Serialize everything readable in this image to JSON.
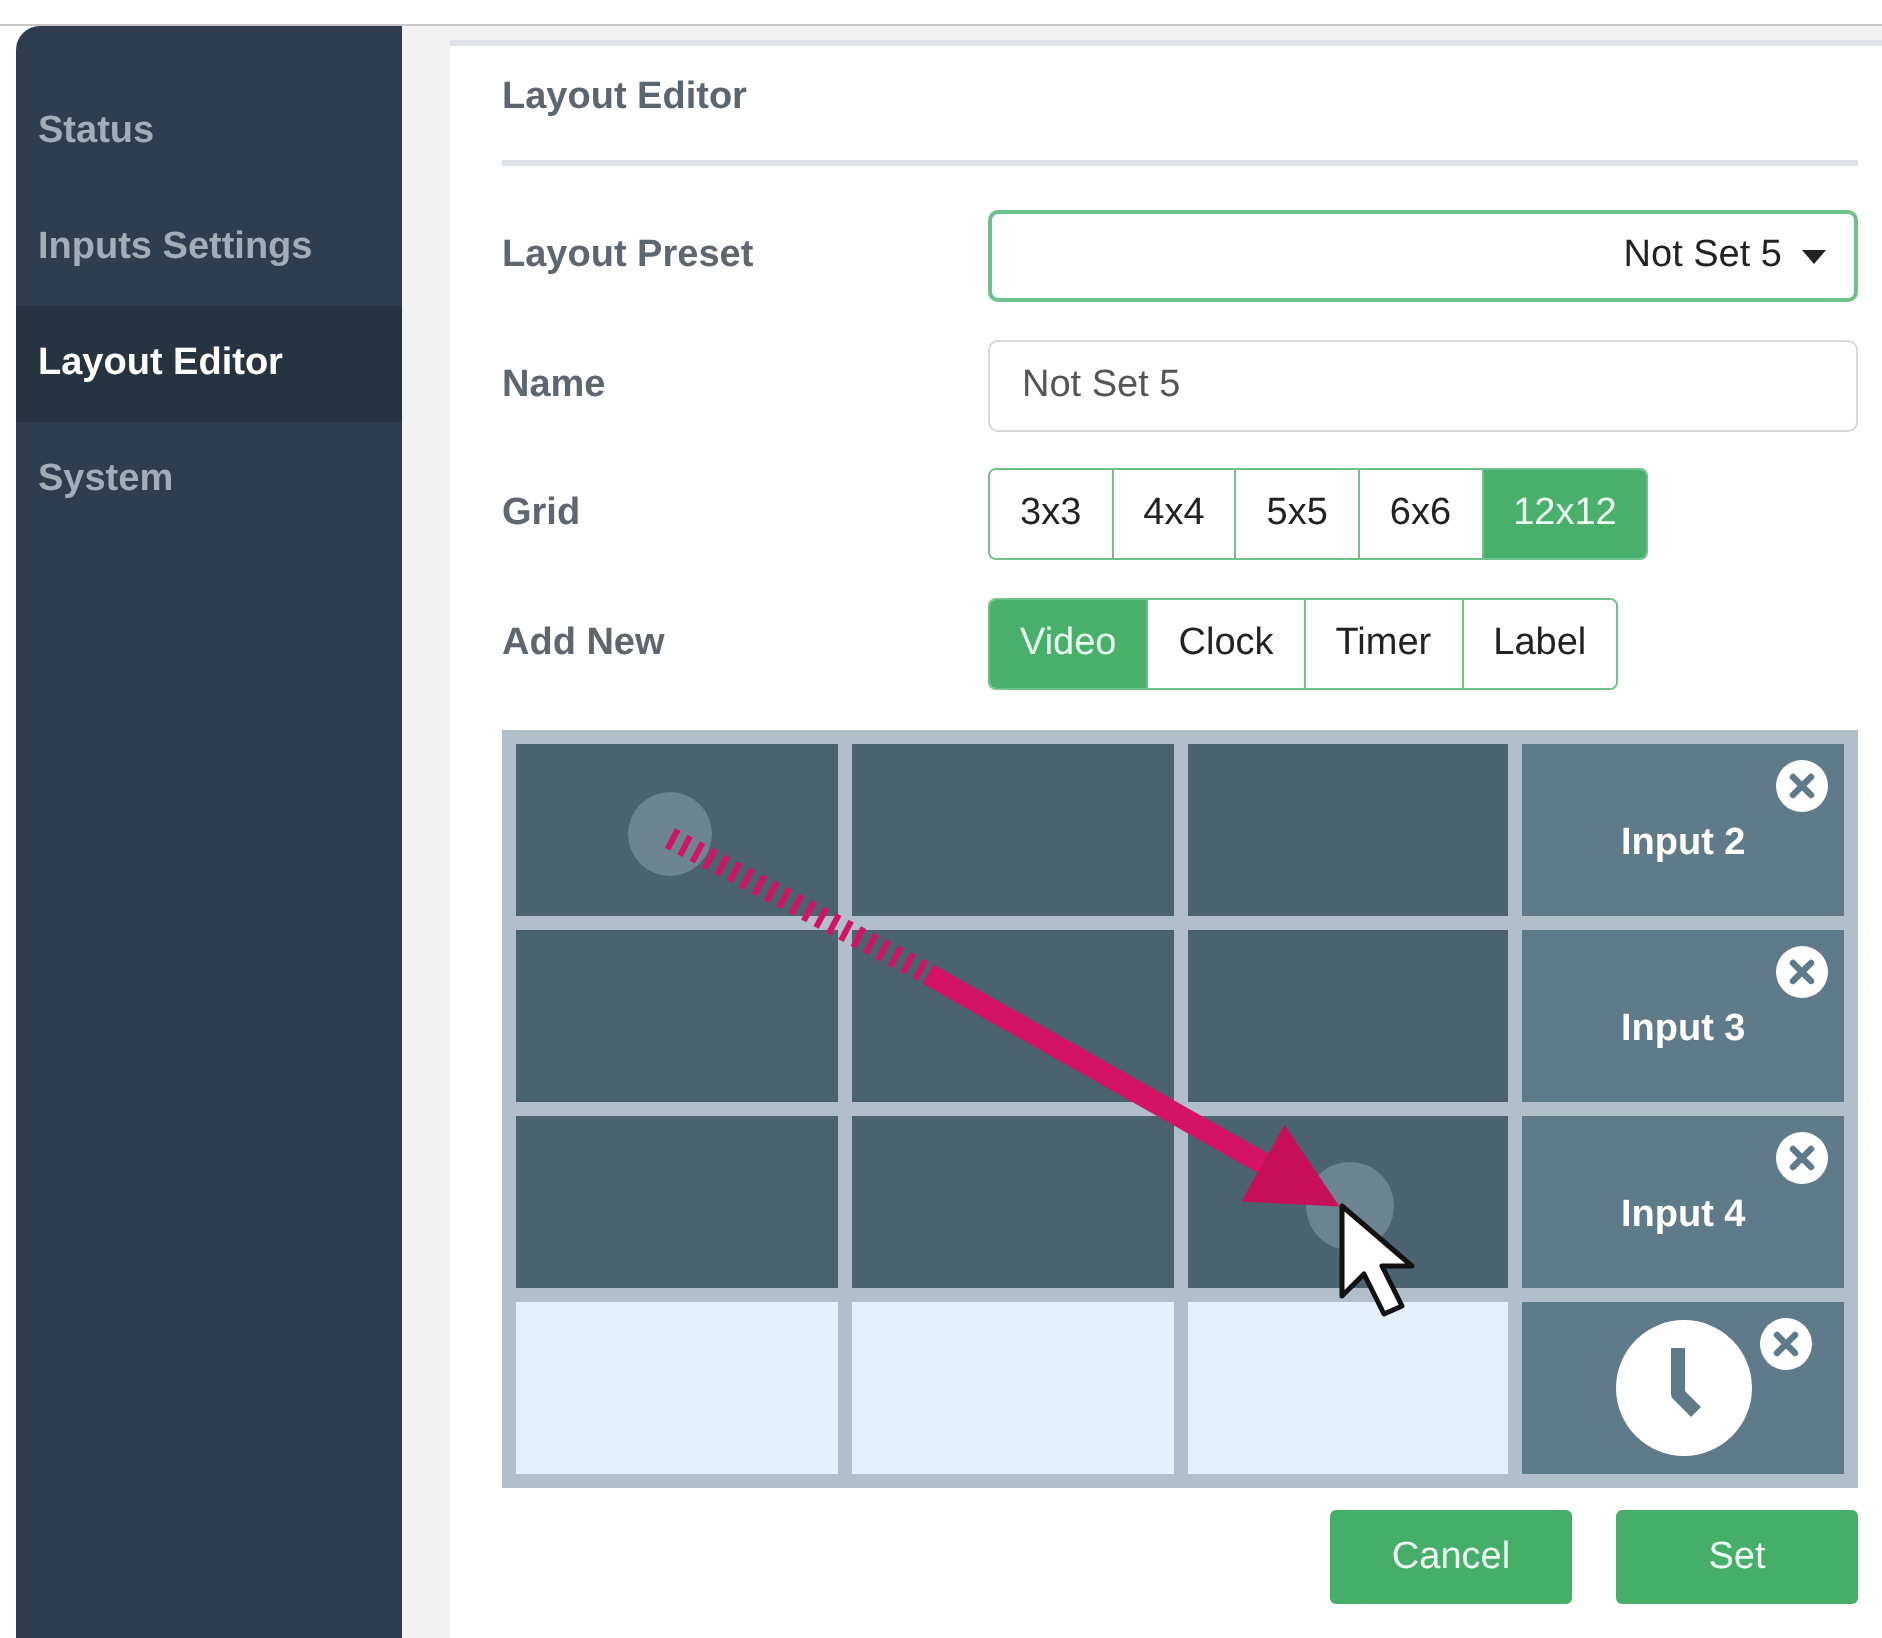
{
  "sidebar": {
    "items": [
      {
        "label": "Status",
        "selected": false
      },
      {
        "label": "Inputs Settings",
        "selected": false
      },
      {
        "label": "Layout Editor",
        "selected": true
      },
      {
        "label": "System",
        "selected": false
      }
    ]
  },
  "panel": {
    "title": "Layout Editor",
    "layout_preset": {
      "label": "Layout Preset",
      "value": "Not Set 5"
    },
    "name": {
      "label": "Name",
      "value": "Not Set 5"
    },
    "grid": {
      "label": "Grid",
      "options": [
        {
          "label": "3x3",
          "selected": false
        },
        {
          "label": "4x4",
          "selected": false
        },
        {
          "label": "5x5",
          "selected": false
        },
        {
          "label": "6x6",
          "selected": false
        },
        {
          "label": "12x12",
          "selected": true
        }
      ]
    },
    "add_new": {
      "label": "Add New",
      "options": [
        {
          "label": "Video",
          "selected": true
        },
        {
          "label": "Clock",
          "selected": false
        },
        {
          "label": "Timer",
          "selected": false
        },
        {
          "label": "Label",
          "selected": false
        }
      ]
    },
    "cells": [
      {
        "kind": "occupied"
      },
      {
        "kind": "occupied"
      },
      {
        "kind": "occupied"
      },
      {
        "kind": "input",
        "label": "Input 2"
      },
      {
        "kind": "occupied"
      },
      {
        "kind": "occupied"
      },
      {
        "kind": "occupied"
      },
      {
        "kind": "input",
        "label": "Input 3"
      },
      {
        "kind": "occupied"
      },
      {
        "kind": "occupied"
      },
      {
        "kind": "occupied"
      },
      {
        "kind": "input",
        "label": "Input 4"
      },
      {
        "kind": "free"
      },
      {
        "kind": "free"
      },
      {
        "kind": "free"
      },
      {
        "kind": "clock"
      }
    ],
    "buttons": [
      {
        "label": "Cancel"
      },
      {
        "label": "Set"
      }
    ]
  }
}
